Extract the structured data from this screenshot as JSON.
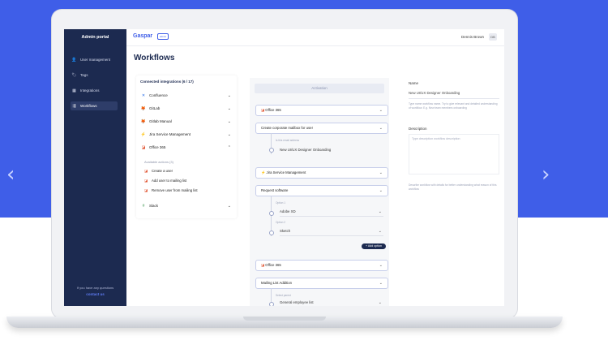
{
  "slider": {
    "prev_icon": "‹",
    "next_icon": "›"
  },
  "sidebar": {
    "title": "Admin portal",
    "items": [
      {
        "label": "User management",
        "icon": "👤",
        "icon_name": "user-icon"
      },
      {
        "label": "Tags",
        "icon": "🏷",
        "icon_name": "tag-icon"
      },
      {
        "label": "Integrations",
        "icon": "▦",
        "icon_name": "grid-icon"
      },
      {
        "label": "Workflows",
        "icon": "⇶",
        "icon_name": "workflow-icon"
      }
    ],
    "active_item": "Workflows",
    "footer_text": "If you have any questions",
    "footer_link": "contact us"
  },
  "topbar": {
    "logo": "Gaspar",
    "logo_badge": "admin",
    "user_name": "Dennis Brown",
    "avatar_initials": "DB"
  },
  "page": {
    "title": "Workflows"
  },
  "integrations": {
    "title": "Connected integrations (6 / 17)",
    "items": [
      {
        "label": "Confluence",
        "icon": "✕",
        "color": "#2a6ee8",
        "chevron": "⌄"
      },
      {
        "label": "GitLab",
        "icon": "🦊",
        "color": "#e2432a",
        "chevron": "⌄"
      },
      {
        "label": "Gitlab Manual",
        "icon": "🦊",
        "color": "#e2432a",
        "chevron": "⌄"
      },
      {
        "label": "Jira Service Management",
        "icon": "⚡",
        "color": "#2a6ee8",
        "chevron": "⌄"
      },
      {
        "label": "Office 365",
        "icon": "◪",
        "color": "#e0502c",
        "chevron": "⌃"
      }
    ],
    "available_actions_label": "Available actions (3)",
    "actions": [
      "Create a user",
      "Add user to mailing list",
      "Remove user from mailing list"
    ],
    "slack": {
      "label": "Slack",
      "icon": "#",
      "chevron": "⌄"
    }
  },
  "workflow": {
    "activation_label": "Activation",
    "step1": {
      "app": "Office 365",
      "action": "Create corporate mailbox for user",
      "param_label": "Is this email address",
      "param_value": "New UI/UX Designer Onboarding"
    },
    "step2": {
      "app": "Jira Service Management",
      "action": "Request software",
      "option1_label": "Option 1",
      "option1_value": "Adobe XD",
      "option2_label": "Option 2",
      "option2_value": "Sketch",
      "add_option": "+ Add option"
    },
    "step3": {
      "app": "Office 365",
      "action": "Mailing List Addition",
      "param_label": "Select parent",
      "param_value": "General employee list"
    }
  },
  "details": {
    "name_label": "Name",
    "name_value": "New UI/UX Designer Onboarding",
    "name_help": "Type name workflow name. Try to give relevant and detailed understanding of workflow. E.g. New team members onboarding",
    "description_label": "Description",
    "description_placeholder": "Type description workflow description",
    "description_help": "Describe workflow with details for better understanding what reason of this workflow"
  }
}
